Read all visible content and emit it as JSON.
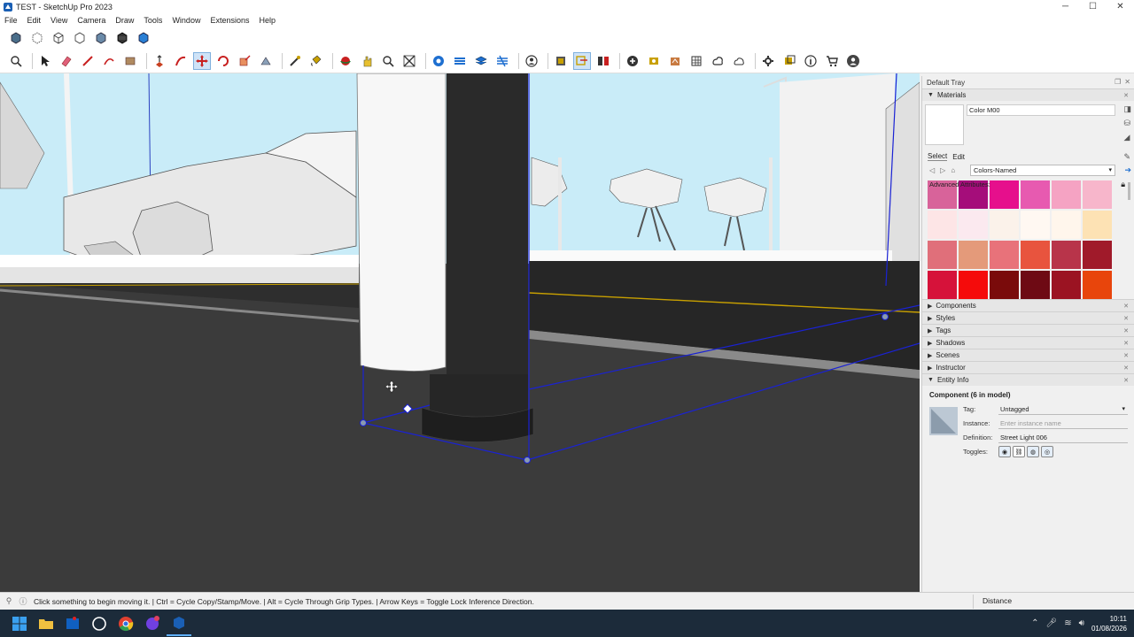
{
  "window": {
    "title": "TEST - SketchUp Pro 2023",
    "controls": {
      "minimize": "─",
      "maximize": "☐",
      "close": "✕"
    }
  },
  "menu": [
    "File",
    "Edit",
    "View",
    "Camera",
    "Draw",
    "Tools",
    "Window",
    "Extensions",
    "Help"
  ],
  "toolbar_icons": {
    "row1": [
      "xray-icon",
      "back-edges-icon",
      "wireframe-icon",
      "hidden-line-icon",
      "shaded-icon",
      "shaded-textures-icon",
      "monochrome-icon"
    ],
    "row2": [
      "zoom-icon",
      "select-icon",
      "eraser-icon",
      "line-icon",
      "shapes-icon",
      "rectangle-icon",
      "push-pull-icon",
      "offset-icon",
      "move-icon",
      "rotate-icon",
      "scale-icon",
      "follow-me-icon",
      "tape-measure-icon",
      "paint-icon",
      "orbit-icon",
      "pan-icon",
      "zoom-window-icon",
      "zoom-extents-icon",
      "3d-warehouse-icon",
      "tags-icon",
      "layers-icon",
      "sandbox-icon",
      "user-icon",
      "model-info-icon",
      "section-icon",
      "components-icon",
      "outliner-icon",
      "add-location-icon",
      "camera-icon",
      "scenes-icon",
      "styles-icon",
      "textures-icon",
      "cloud-icon",
      "settings-icon",
      "dynamic-icon",
      "info-icon",
      "cart-icon",
      "account-icon"
    ]
  },
  "tray": {
    "title": "Default Tray",
    "materials": {
      "heading": "Materials",
      "current_name": "Color M00",
      "tabs": [
        "Select",
        "Edit"
      ],
      "library": "Colors-Named",
      "swatches": [
        "#d8639a",
        "#a50d7a",
        "#e60f8c",
        "#e75ab0",
        "#f5a3c3",
        "#f7b6cb",
        "#fde5e6",
        "#fbe9ef",
        "#fbf2ea",
        "#fff8f2",
        "#fff6ec",
        "#fde2b4",
        "#e06f7a",
        "#e49a7a",
        "#e8727a",
        "#e8543e",
        "#b8344a",
        "#a01a2a",
        "#d6123a",
        "#f50b0b",
        "#7a0b0b",
        "#6e0a14",
        "#9b1322",
        "#e8450c"
      ]
    },
    "collapsed_panels": [
      "Components",
      "Styles",
      "Tags",
      "Shadows",
      "Scenes",
      "Instructor"
    ],
    "entity_info": {
      "heading": "Entity Info",
      "title": "Component (6 in model)",
      "tag_label": "Tag:",
      "tag_value": "Untagged",
      "instance_label": "Instance:",
      "instance_placeholder": "Enter instance name",
      "definition_label": "Definition:",
      "definition_value": "Street Light 006",
      "toggles_label": "Toggles:",
      "advanced_label": "Advanced Attributes:"
    }
  },
  "status": {
    "message": "Click something to begin moving it. | Ctrl = Cycle Copy/Stamp/Move. | Alt = Cycle Through Grip Types. | Arrow Keys = Toggle Lock Inference Direction.",
    "vcb_label": "Distance"
  },
  "taskbar": {
    "time": "10:11",
    "date": "01/08/2026",
    "apps": [
      "windows-start-icon",
      "file-explorer-icon",
      "outlook-icon",
      "chatgpt-icon",
      "chrome-icon",
      "messenger-icon",
      "sketchup-icon"
    ]
  },
  "colors": {
    "viewport_sky": "#bfe6f5",
    "ground": "#3a3a3a",
    "selection": "#1a22d4",
    "inference_yellow": "#c8a000"
  }
}
